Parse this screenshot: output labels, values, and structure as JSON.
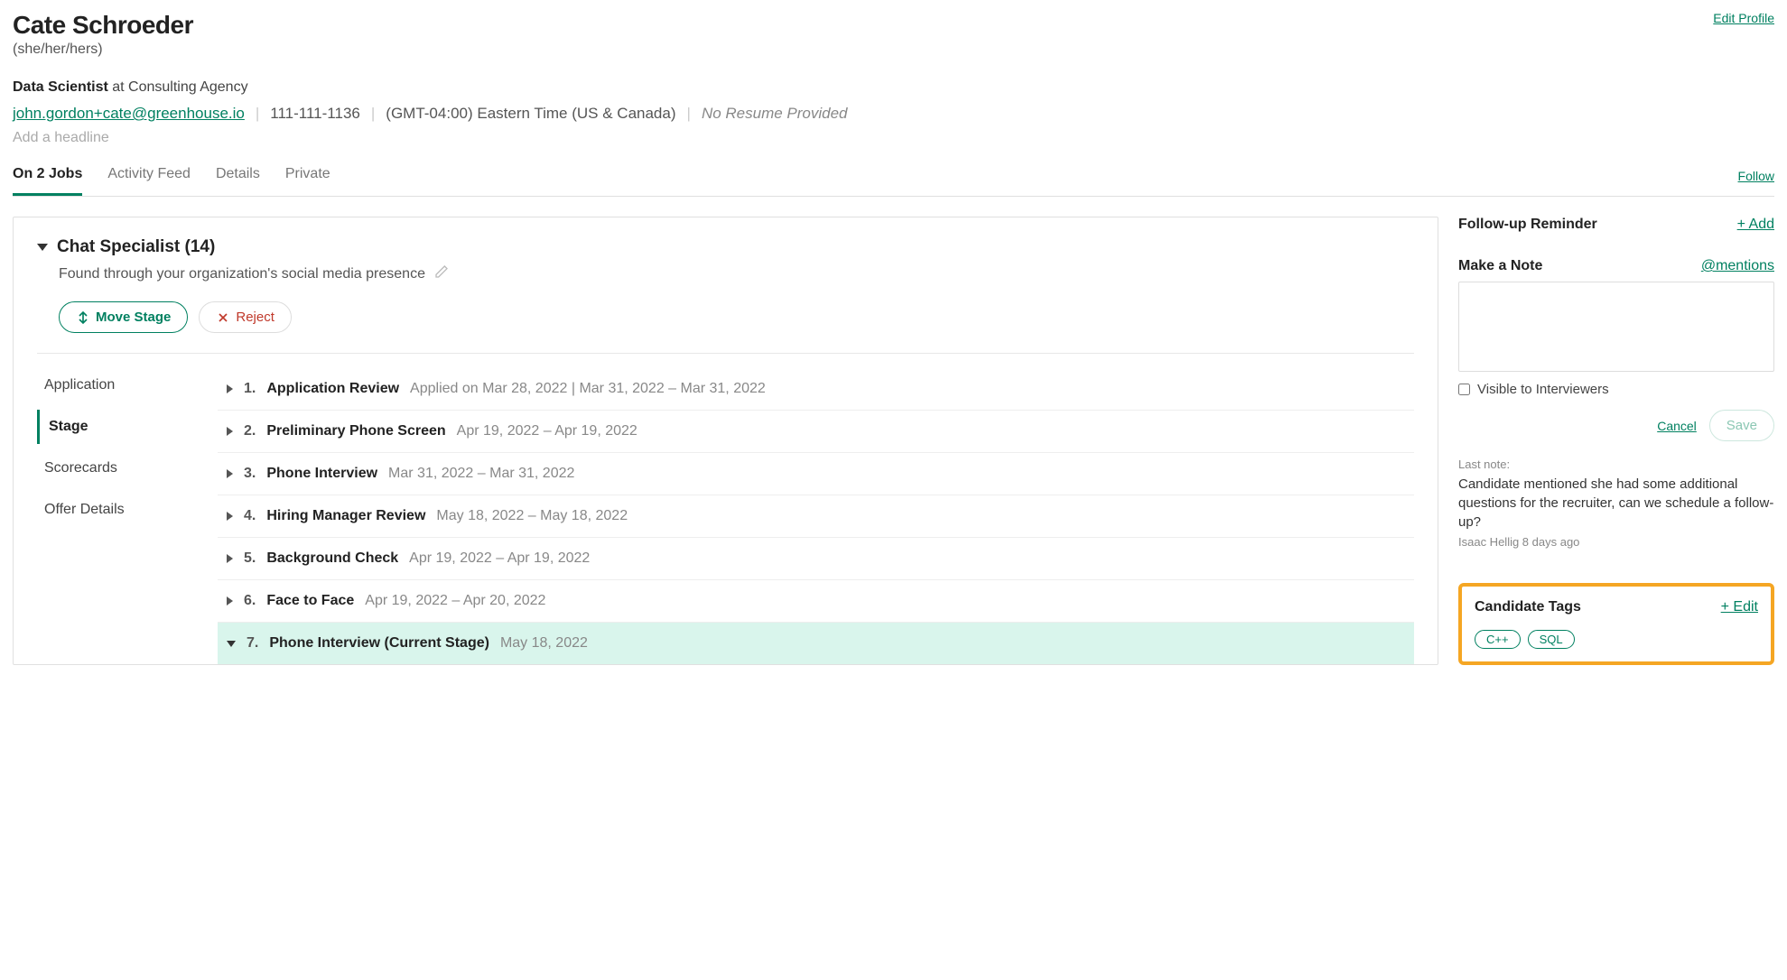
{
  "header": {
    "name": "Cate Schroeder",
    "pronouns": "(she/her/hers)",
    "edit_profile": "Edit Profile",
    "role": "Data Scientist",
    "role_at": " at Consulting Agency",
    "email": "john.gordon+cate@greenhouse.io",
    "phone": "111-111-1136",
    "timezone": "(GMT-04:00) Eastern Time (US & Canada)",
    "no_resume": "No Resume Provided",
    "headline_placeholder": "Add a headline"
  },
  "tabs": {
    "items": [
      "On 2 Jobs",
      "Activity Feed",
      "Details",
      "Private"
    ],
    "follow": "Follow"
  },
  "job": {
    "title": "Chat Specialist (14)",
    "source": "Found through your organization's social media presence",
    "move_stage": "Move Stage",
    "reject": "Reject"
  },
  "side_tabs": [
    "Application",
    "Stage",
    "Scorecards",
    "Offer Details"
  ],
  "stages": [
    {
      "num": "1.",
      "name": "Application Review",
      "date": "Applied on Mar 28, 2022 | Mar 31, 2022 – Mar 31, 2022",
      "current": false
    },
    {
      "num": "2.",
      "name": "Preliminary Phone Screen",
      "date": "Apr 19, 2022 – Apr 19, 2022",
      "current": false
    },
    {
      "num": "3.",
      "name": "Phone Interview",
      "date": "Mar 31, 2022 – Mar 31, 2022",
      "current": false
    },
    {
      "num": "4.",
      "name": "Hiring Manager Review",
      "date": "May 18, 2022 – May 18, 2022",
      "current": false
    },
    {
      "num": "5.",
      "name": "Background Check",
      "date": "Apr 19, 2022 – Apr 19, 2022",
      "current": false
    },
    {
      "num": "6.",
      "name": "Face to Face",
      "date": "Apr 19, 2022 – Apr 20, 2022",
      "current": false
    },
    {
      "num": "7.",
      "name": "Phone Interview (Current Stage)",
      "date": "May 18, 2022",
      "current": true
    }
  ],
  "sidebar": {
    "followup": {
      "title": "Follow-up Reminder",
      "add": "+ Add"
    },
    "note": {
      "title": "Make a Note",
      "mentions": "@mentions",
      "visible_label": "Visible to Interviewers",
      "cancel": "Cancel",
      "save": "Save",
      "last_note_label": "Last note:",
      "last_note_text": "Candidate mentioned she had some additional questions for the recruiter, can we schedule a follow-up?",
      "last_note_meta": "Isaac Hellig 8 days ago"
    },
    "tags": {
      "title": "Candidate Tags",
      "edit": "+ Edit",
      "items": [
        "C++",
        "SQL"
      ]
    }
  }
}
